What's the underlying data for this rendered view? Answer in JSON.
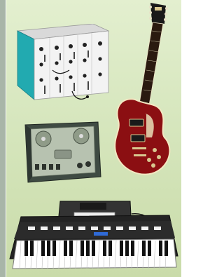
{
  "scene": {
    "background_top": "#e3efcf",
    "background_bottom": "#c9dba9",
    "items": [
      {
        "name": "modular-synthesizer",
        "color": "#f2f2f2",
        "accent": "#22aab0"
      },
      {
        "name": "electric-guitar",
        "color": "#8b0f12",
        "accent": "#f3e7c2"
      },
      {
        "name": "reel-to-reel-tape-recorder",
        "color": "#3f4b43",
        "accent": "#aeb9a7"
      },
      {
        "name": "keyboard-synthesizer",
        "color": "#232323",
        "accent": "#ffffff"
      }
    ]
  }
}
